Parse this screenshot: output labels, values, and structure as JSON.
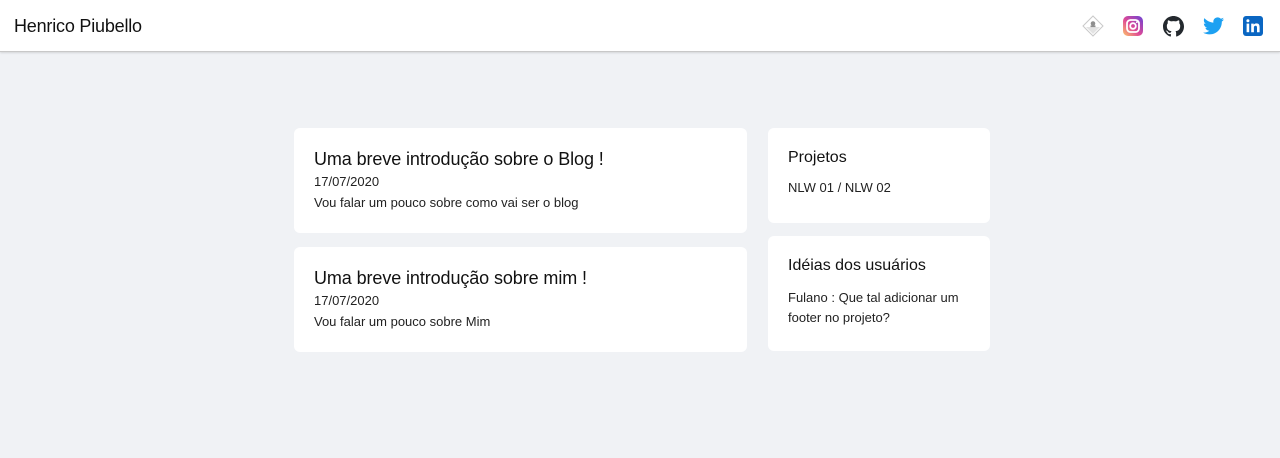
{
  "header": {
    "title": "Henrico Piubello",
    "socials": [
      {
        "icon": "diamond-logo-icon",
        "color": "#9e9e9e"
      },
      {
        "icon": "instagram-icon",
        "color": "#d6249f"
      },
      {
        "icon": "github-icon",
        "color": "#24292e"
      },
      {
        "icon": "twitter-icon",
        "color": "#1da1f2"
      },
      {
        "icon": "linkedin-icon",
        "color": "#0a66c2"
      }
    ]
  },
  "posts": [
    {
      "title": "Uma breve introdução sobre o Blog !",
      "date": "17/07/2020",
      "excerpt": "Vou falar um pouco sobre como vai ser o blog"
    },
    {
      "title": "Uma breve introdução sobre mim !",
      "date": "17/07/2020",
      "excerpt": "Vou falar um pouco sobre Mim"
    }
  ],
  "sidebar": {
    "projects": {
      "title": "Projetos",
      "body": "NLW 01 / NLW 02"
    },
    "ideas": {
      "title": "Idéias dos usuários",
      "body": "Fulano : Que tal adicionar um footer no projeto?"
    }
  },
  "colors": {
    "background": "#f0f2f5",
    "card": "#ffffff",
    "header": "#ffffff"
  }
}
